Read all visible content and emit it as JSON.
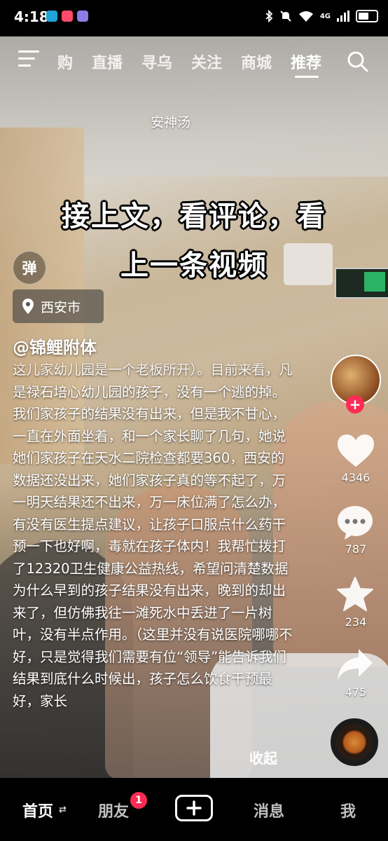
{
  "status_bar": {
    "time": "4:18",
    "network": "4G",
    "app_icon_colors": [
      "#1fa3d8",
      "#ff4a6d",
      "#8d7be6"
    ]
  },
  "top_nav": {
    "tabs": [
      {
        "label": "购",
        "partial": true
      },
      {
        "label": "直播"
      },
      {
        "label": "寻乌"
      },
      {
        "label": "关注"
      },
      {
        "label": "商城"
      },
      {
        "label": "推荐",
        "active": true
      }
    ]
  },
  "video": {
    "music_title": "安神汤",
    "caption_lines": [
      "接上文，看评论，看",
      "上一条视频"
    ],
    "danmu_label": "弹",
    "location": "西安市",
    "author": "@锦鲤附体",
    "description": "这儿家幼儿园是一个老板所开）。目前来看，凡是禄石培心幼儿园的孩子，没有一个逃的掉。我们家孩子的结果没有出来，但是我不甘心，一直在外面坐着，和一个家长聊了几句，她说她们家孩子在天水二院检查都要360，西安的数据还没出来，她们家孩子真的等不起了，万一明天结果还不出来，万一床位满了怎么办，有没有医生提点建议，让孩子口服点什么药干预一下也好啊，毒就在孩子体内！我帮忙拨打了12320卫生健康公益热线，希望问清楚数据为什么早到的孩子结果没有出来，晚到的却出来了，但仿佛我往一滩死水中丢进了一片树叶，没有半点作用。（这里并没有说医院哪哪不好，只是觉得我们需要有位“领导”能告诉我们结果到底什么时候出，孩子怎么饮食干预最好，家长",
    "collapse_label": "收起"
  },
  "actions": {
    "likes": "4346",
    "comments": "787",
    "favorites": "234",
    "shares": "475",
    "follow_symbol": "+"
  },
  "bottom_nav": {
    "home": "首页",
    "friends": "朋友",
    "friends_badge": "1",
    "messages": "消息",
    "me": "我"
  },
  "colors": {
    "accent": "#fe2c55",
    "background": "#000000"
  }
}
